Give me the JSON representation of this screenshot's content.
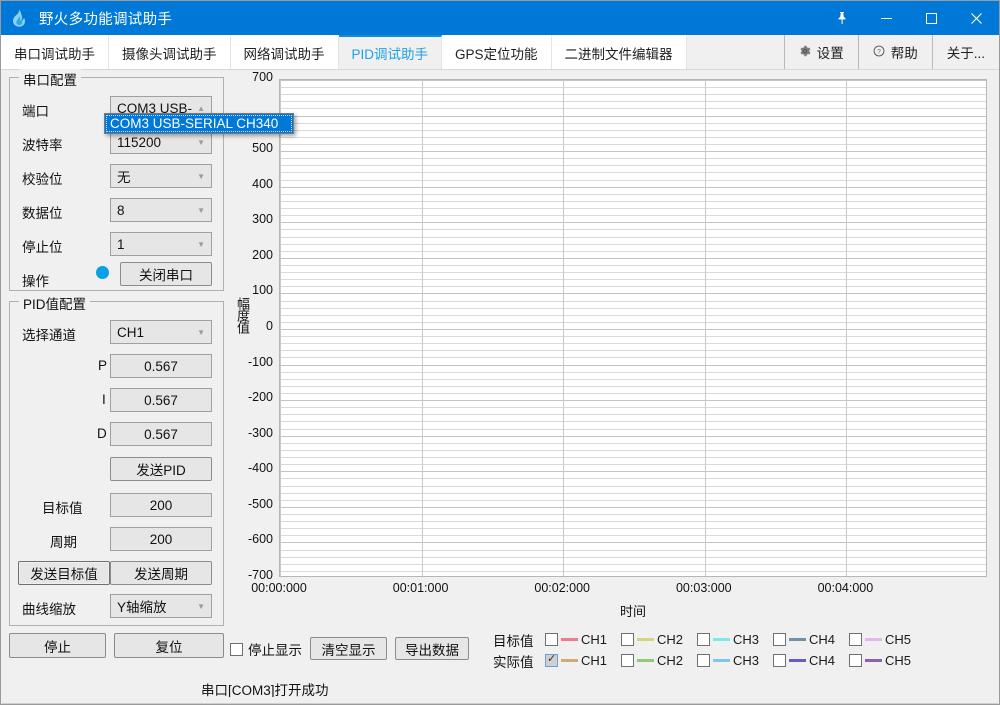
{
  "window": {
    "title": "野火多功能调试助手",
    "app_icon": "flame-icon",
    "buttons": {
      "pin": "pin-icon",
      "minimize": "minimize-icon",
      "maximize": "maximize-icon",
      "close": "close-icon"
    }
  },
  "tabs": [
    {
      "label": "串口调试助手",
      "active": false
    },
    {
      "label": "摄像头调试助手",
      "active": false
    },
    {
      "label": "网络调试助手",
      "active": false
    },
    {
      "label": "PID调试助手",
      "active": true
    },
    {
      "label": "GPS定位功能",
      "active": false
    },
    {
      "label": "二进制文件编辑器",
      "active": false
    }
  ],
  "right_tools": [
    {
      "label": "设置",
      "icon": "gear-icon"
    },
    {
      "label": "帮助",
      "icon": "question-circle-icon"
    },
    {
      "label": "关于...",
      "icon": ""
    }
  ],
  "serial_group": {
    "title": "串口配置",
    "fields": [
      {
        "label": "端口",
        "value": "COM3 USB-",
        "type": "combo"
      },
      {
        "label": "波特率",
        "value": "115200",
        "type": "combo"
      },
      {
        "label": "校验位",
        "value": "无",
        "type": "combo"
      },
      {
        "label": "数据位",
        "value": "8",
        "type": "combo"
      },
      {
        "label": "停止位",
        "value": "1",
        "type": "combo"
      }
    ],
    "operation_label": "操作",
    "operation_button": "关闭串口",
    "status_dot_color": "#09a0e8"
  },
  "port_dropdown": {
    "open": true,
    "selected_item": "COM3 USB-SERIAL CH340",
    "highlight_color": "#0078d7"
  },
  "pid_group": {
    "title": "PID值配置",
    "channel_label": "选择通道",
    "channel_value": "CH1",
    "p_label": "P",
    "p_value": "0.567",
    "i_label": "I",
    "i_value": "0.567",
    "d_label": "D",
    "d_value": "0.567",
    "send_pid_button": "发送PID",
    "target_label": "目标值",
    "target_value": "200",
    "period_label": "周期",
    "period_value": "200",
    "send_target_button": "发送目标值",
    "send_period_button": "发送周期",
    "zoom_label": "曲线缩放",
    "zoom_value": "Y轴缩放"
  },
  "bottom_controls": {
    "stop_button": "停止",
    "reset_button": "复位",
    "stop_display_label": "停止显示",
    "stop_display_checked": false,
    "clear_button": "清空显示",
    "export_button": "导出数据"
  },
  "status_text": "串口[COM3]打开成功",
  "legend": {
    "rows": [
      {
        "name": "目标值",
        "items": [
          {
            "label": "CH1",
            "color": "#ef7b8e",
            "checked": false
          },
          {
            "label": "CH2",
            "color": "#d9d47a",
            "checked": false
          },
          {
            "label": "CH3",
            "color": "#79e9e9",
            "checked": false
          },
          {
            "label": "CH4",
            "color": "#6f93a5",
            "checked": false
          },
          {
            "label": "CH5",
            "color": "#e3b6f0",
            "checked": false
          }
        ]
      },
      {
        "name": "实际值",
        "items": [
          {
            "label": "CH1",
            "color": "#d3a877",
            "checked": true
          },
          {
            "label": "CH2",
            "color": "#95c878",
            "checked": false
          },
          {
            "label": "CH3",
            "color": "#7ec6ea",
            "checked": false
          },
          {
            "label": "CH4",
            "color": "#6a5ac4",
            "checked": false
          },
          {
            "label": "CH5",
            "color": "#8f5fb0",
            "checked": false
          }
        ]
      }
    ]
  },
  "chart_data": {
    "type": "line",
    "title": "",
    "xlabel": "时间",
    "ylabel": "幅度值",
    "ylim": [
      -700,
      700
    ],
    "y_ticks": [
      700,
      600,
      500,
      400,
      300,
      200,
      100,
      0,
      -100,
      -200,
      -300,
      -400,
      -500,
      -600,
      -700
    ],
    "y_tick_labels": [
      "700",
      "",
      "500",
      "400",
      "300",
      "200",
      "100",
      "0",
      "-100",
      "-200",
      "-300",
      "-400",
      "-500",
      "-600",
      "-700"
    ],
    "y_minor_step": 20,
    "x_ticks": [
      "00:00:000",
      "00:01:000",
      "00:02:000",
      "00:03:000",
      "00:04:000"
    ],
    "xlim": [
      0,
      5
    ],
    "grid": true,
    "legend_position": "bottom",
    "series": [
      {
        "name": "目标值 CH1",
        "color": "#ef7b8e",
        "visible": false,
        "values": []
      },
      {
        "name": "目标值 CH2",
        "color": "#d9d47a",
        "visible": false,
        "values": []
      },
      {
        "name": "目标值 CH3",
        "color": "#79e9e9",
        "visible": false,
        "values": []
      },
      {
        "name": "目标值 CH4",
        "color": "#6f93a5",
        "visible": false,
        "values": []
      },
      {
        "name": "目标值 CH5",
        "color": "#e3b6f0",
        "visible": false,
        "values": []
      },
      {
        "name": "实际值 CH1",
        "color": "#d3a877",
        "visible": true,
        "values": []
      },
      {
        "name": "实际值 CH2",
        "color": "#95c878",
        "visible": false,
        "values": []
      },
      {
        "name": "实际值 CH3",
        "color": "#7ec6ea",
        "visible": false,
        "values": []
      },
      {
        "name": "实际值 CH4",
        "color": "#6a5ac4",
        "visible": false,
        "values": []
      },
      {
        "name": "实际值 CH5",
        "color": "#8f5fb0",
        "visible": false,
        "values": []
      }
    ]
  }
}
